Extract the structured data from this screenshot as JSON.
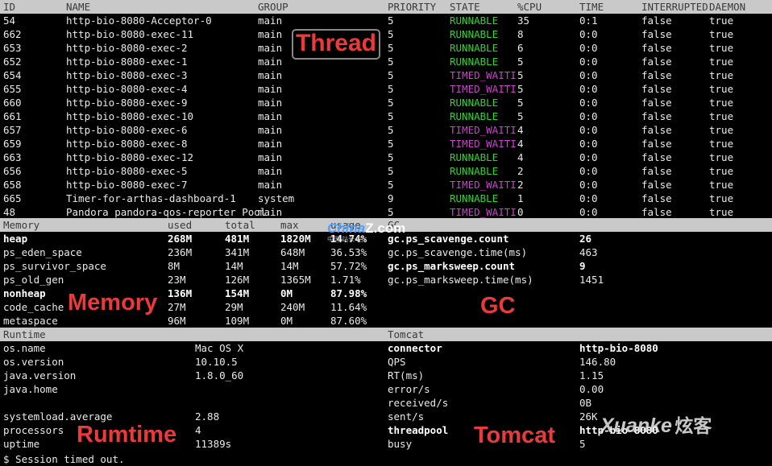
{
  "thread": {
    "headers": [
      "ID",
      "NAME",
      "GROUP",
      "PRIORITY",
      "STATE",
      "%CPU",
      "TIME",
      "INTERRUPTED",
      "DAEMON"
    ],
    "rows": [
      [
        "54",
        "http-bio-8080-Acceptor-0",
        "main",
        "5",
        "RUNNABLE",
        "35",
        "0:1",
        "false",
        "true"
      ],
      [
        "662",
        "http-bio-8080-exec-11",
        "main",
        "5",
        "RUNNABLE",
        "8",
        "0:0",
        "false",
        "true"
      ],
      [
        "653",
        "http-bio-8080-exec-2",
        "main",
        "5",
        "RUNNABLE",
        "6",
        "0:0",
        "false",
        "true"
      ],
      [
        "652",
        "http-bio-8080-exec-1",
        "main",
        "5",
        "RUNNABLE",
        "5",
        "0:0",
        "false",
        "true"
      ],
      [
        "654",
        "http-bio-8080-exec-3",
        "main",
        "5",
        "TIMED_WAITI",
        "5",
        "0:0",
        "false",
        "true"
      ],
      [
        "655",
        "http-bio-8080-exec-4",
        "main",
        "5",
        "TIMED_WAITI",
        "5",
        "0:0",
        "false",
        "true"
      ],
      [
        "660",
        "http-bio-8080-exec-9",
        "main",
        "5",
        "RUNNABLE",
        "5",
        "0:0",
        "false",
        "true"
      ],
      [
        "661",
        "http-bio-8080-exec-10",
        "main",
        "5",
        "RUNNABLE",
        "5",
        "0:0",
        "false",
        "true"
      ],
      [
        "657",
        "http-bio-8080-exec-6",
        "main",
        "5",
        "TIMED_WAITI",
        "4",
        "0:0",
        "false",
        "true"
      ],
      [
        "659",
        "http-bio-8080-exec-8",
        "main",
        "5",
        "TIMED_WAITI",
        "4",
        "0:0",
        "false",
        "true"
      ],
      [
        "663",
        "http-bio-8080-exec-12",
        "main",
        "5",
        "RUNNABLE",
        "4",
        "0:0",
        "false",
        "true"
      ],
      [
        "656",
        "http-bio-8080-exec-5",
        "main",
        "5",
        "RUNNABLE",
        "2",
        "0:0",
        "false",
        "true"
      ],
      [
        "658",
        "http-bio-8080-exec-7",
        "main",
        "5",
        "TIMED_WAITI",
        "2",
        "0:0",
        "false",
        "true"
      ],
      [
        "665",
        "Timer-for-arthas-dashboard-1",
        "system",
        "9",
        "RUNNABLE",
        "1",
        "0:0",
        "false",
        "true"
      ],
      [
        "48",
        "Pandora pandora-qos-reporter Pool",
        "main",
        "5",
        "TIMED_WAITI",
        "0",
        "0:0",
        "false",
        "true"
      ]
    ],
    "state_colors": {
      "RUNNABLE": "#2fd52f",
      "TIMED_WAITI": "#d43cd4"
    }
  },
  "memory": {
    "headers": [
      "Memory",
      "used",
      "total",
      "max",
      "usage"
    ],
    "rows": [
      {
        "cells": [
          "heap",
          "268M",
          "481M",
          "1820M",
          "14.74%"
        ],
        "bold": true
      },
      {
        "cells": [
          "ps_eden_space",
          "236M",
          "341M",
          "648M",
          "36.53%"
        ],
        "bold": false
      },
      {
        "cells": [
          "ps_survivor_space",
          "8M",
          "14M",
          "14M",
          "57.72%"
        ],
        "bold": false
      },
      {
        "cells": [
          "ps_old_gen",
          "23M",
          "126M",
          "1365M",
          "1.71%"
        ],
        "bold": false
      },
      {
        "cells": [
          "nonheap",
          "136M",
          "154M",
          "0M",
          "87.98%"
        ],
        "bold": true
      },
      {
        "cells": [
          "code_cache",
          "27M",
          "29M",
          "240M",
          "11.64%"
        ],
        "bold": false
      },
      {
        "cells": [
          "metaspace",
          "96M",
          "109M",
          "0M",
          "87.60%"
        ],
        "bold": false
      }
    ]
  },
  "gc": {
    "header": "GC",
    "rows": [
      {
        "cells": [
          "gc.ps_scavenge.count",
          "26"
        ],
        "bold": true
      },
      {
        "cells": [
          "gc.ps_scavenge.time(ms)",
          "463"
        ],
        "bold": false
      },
      {
        "cells": [
          "gc.ps_marksweep.count",
          "9"
        ],
        "bold": true
      },
      {
        "cells": [
          "gc.ps_marksweep.time(ms)",
          "1451"
        ],
        "bold": false
      }
    ]
  },
  "runtime": {
    "header": "Runtime",
    "rows": [
      [
        "os.name",
        "Mac OS X"
      ],
      [
        "os.version",
        "10.10.5"
      ],
      [
        "java.version",
        "1.8.0_60"
      ],
      [
        "java.home",
        ""
      ],
      [
        "",
        ""
      ],
      [
        "systemload.average",
        "2.88"
      ],
      [
        "processors",
        "4"
      ],
      [
        "uptime",
        "11389s"
      ]
    ]
  },
  "tomcat": {
    "header": "Tomcat",
    "rows": [
      {
        "cells": [
          "connector",
          "http-bio-8080"
        ],
        "bold": true
      },
      {
        "cells": [
          "QPS",
          "146.80"
        ],
        "bold": false
      },
      {
        "cells": [
          "RT(ms)",
          "1.15"
        ],
        "bold": false
      },
      {
        "cells": [
          "error/s",
          "0.00"
        ],
        "bold": false
      },
      {
        "cells": [
          "received/s",
          "0B"
        ],
        "bold": false
      },
      {
        "cells": [
          "sent/s",
          "26K"
        ],
        "bold": false
      },
      {
        "cells": [
          "threadpool",
          "http-bio-8080"
        ],
        "bold": true
      },
      {
        "cells": [
          "busy",
          "5"
        ],
        "bold": false
      }
    ]
  },
  "annotations": {
    "thread": "Thread",
    "memory": "Memory",
    "gc": "GC",
    "runtime": "Rumtime",
    "tomcat": "Tomcat",
    "color": "#ea3a3a"
  },
  "watermarks": {
    "china": "China",
    "china_suffix": "Z.com",
    "china_sub": "中国 站长 站",
    "xuanke": "Xuanke",
    "xuanke_cn": "炫客"
  },
  "status_line": "$ Session timed out."
}
